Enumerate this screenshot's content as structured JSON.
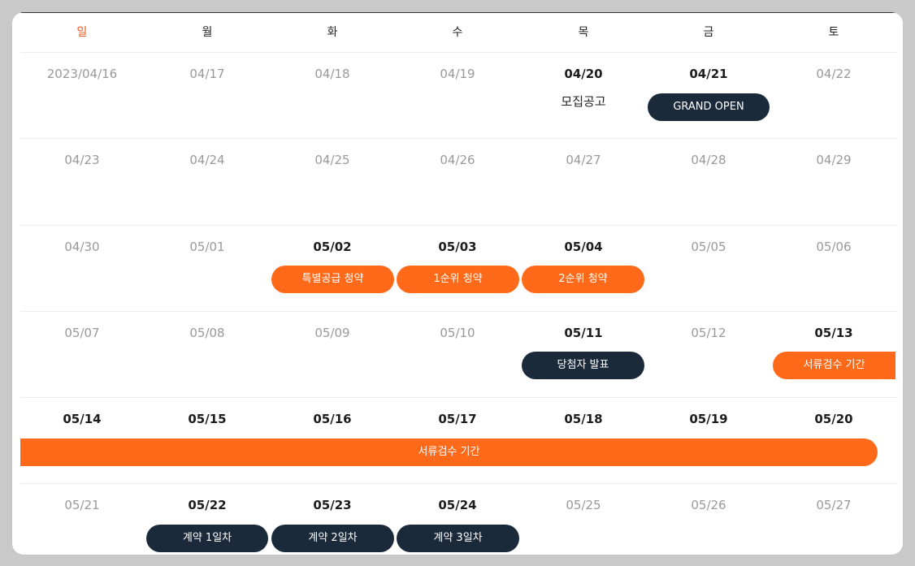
{
  "weekdays": [
    "일",
    "월",
    "화",
    "수",
    "목",
    "금",
    "토"
  ],
  "weeks": [
    [
      {
        "date": "2023/04/16",
        "active": false
      },
      {
        "date": "04/17",
        "active": false
      },
      {
        "date": "04/18",
        "active": false
      },
      {
        "date": "04/19",
        "active": false
      },
      {
        "date": "04/20",
        "active": true
      },
      {
        "date": "04/21",
        "active": true
      },
      {
        "date": "04/22",
        "active": false
      }
    ],
    [
      {
        "date": "04/23",
        "active": false
      },
      {
        "date": "04/24",
        "active": false
      },
      {
        "date": "04/25",
        "active": false
      },
      {
        "date": "04/26",
        "active": false
      },
      {
        "date": "04/27",
        "active": false
      },
      {
        "date": "04/28",
        "active": false
      },
      {
        "date": "04/29",
        "active": false
      }
    ],
    [
      {
        "date": "04/30",
        "active": false
      },
      {
        "date": "05/01",
        "active": false
      },
      {
        "date": "05/02",
        "active": true
      },
      {
        "date": "05/03",
        "active": true
      },
      {
        "date": "05/04",
        "active": true
      },
      {
        "date": "05/05",
        "active": false
      },
      {
        "date": "05/06",
        "active": false
      }
    ],
    [
      {
        "date": "05/07",
        "active": false
      },
      {
        "date": "05/08",
        "active": false
      },
      {
        "date": "05/09",
        "active": false
      },
      {
        "date": "05/10",
        "active": false
      },
      {
        "date": "05/11",
        "active": true
      },
      {
        "date": "05/12",
        "active": false
      },
      {
        "date": "05/13",
        "active": true
      }
    ],
    [
      {
        "date": "05/14",
        "active": true
      },
      {
        "date": "05/15",
        "active": true
      },
      {
        "date": "05/16",
        "active": true
      },
      {
        "date": "05/17",
        "active": true
      },
      {
        "date": "05/18",
        "active": true
      },
      {
        "date": "05/19",
        "active": true
      },
      {
        "date": "05/20",
        "active": true
      }
    ],
    [
      {
        "date": "05/21",
        "active": false
      },
      {
        "date": "05/22",
        "active": true
      },
      {
        "date": "05/23",
        "active": true
      },
      {
        "date": "05/24",
        "active": true
      },
      {
        "date": "05/25",
        "active": false
      },
      {
        "date": "05/26",
        "active": false
      },
      {
        "date": "05/27",
        "active": false
      }
    ]
  ],
  "notes": {
    "recruit_notice": "모집공고"
  },
  "events": {
    "grand_open": "GRAND OPEN",
    "special_supply": "특별공급 청약",
    "first_rank": "1순위 청약",
    "second_rank": "2순위 청약",
    "winner_announce": "당첨자 발표",
    "doc_review_1": "서류검수 기간",
    "doc_review_2": "서류검수 기간",
    "contract_day1": "계약 1일차",
    "contract_day2": "계약 2일차",
    "contract_day3": "계약 3일차"
  },
  "colors": {
    "accent_orange": "#ff6a1a",
    "dark_navy": "#1b2a3b",
    "sunday_red": "#e8551a"
  }
}
